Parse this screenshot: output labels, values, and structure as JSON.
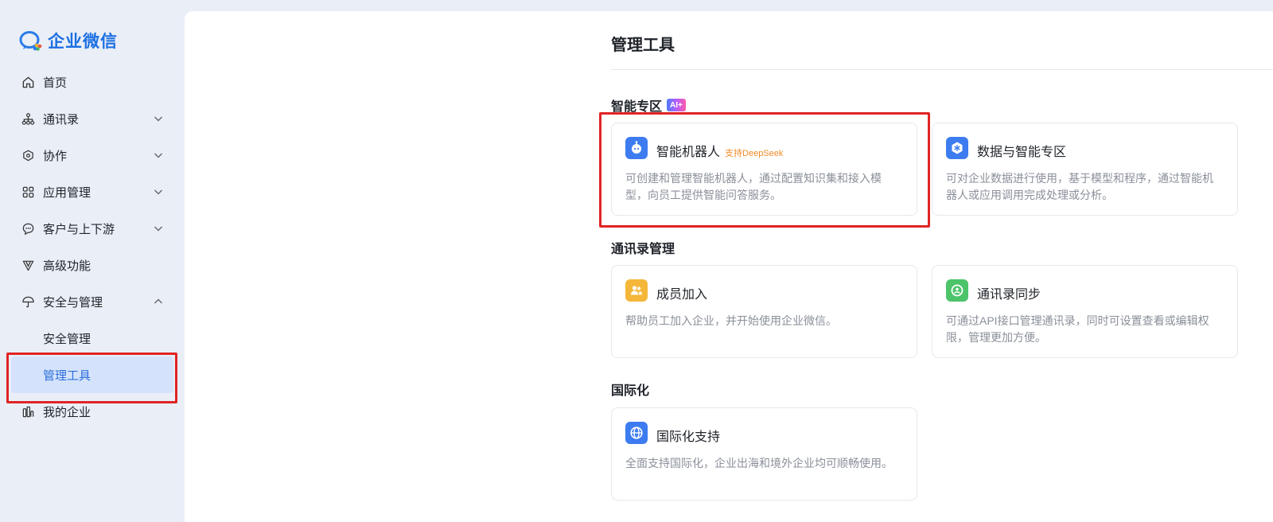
{
  "brand": {
    "name": "企业微信"
  },
  "sidebar": {
    "items": [
      {
        "label": "首页",
        "icon": "home-icon"
      },
      {
        "label": "通讯录",
        "icon": "org-icon",
        "chevron": "down"
      },
      {
        "label": "协作",
        "icon": "collab-icon",
        "chevron": "down"
      },
      {
        "label": "应用管理",
        "icon": "apps-icon",
        "chevron": "down"
      },
      {
        "label": "客户与上下游",
        "icon": "chat-icon",
        "chevron": "down"
      },
      {
        "label": "高级功能",
        "icon": "advanced-icon"
      },
      {
        "label": "安全与管理",
        "icon": "umbrella-icon",
        "chevron": "up"
      },
      {
        "label": "安全管理"
      },
      {
        "label": "管理工具",
        "active": true
      },
      {
        "label": "我的企业",
        "icon": "company-icon"
      }
    ]
  },
  "main": {
    "title": "管理工具",
    "sections": [
      {
        "title": "智能专区",
        "badge": "AI+"
      },
      {
        "title": "通讯录管理"
      },
      {
        "title": "国际化"
      }
    ],
    "cards": [
      {
        "title": "智能机器人",
        "tag": "支持DeepSeek",
        "desc": "可创建和管理智能机器人，通过配置知识集和接入模型，向员工提供智能问答服务。",
        "icon": "robot-icon",
        "color": "#3d7cf0"
      },
      {
        "title": "数据与智能专区",
        "desc": "可对企业数据进行使用，基于模型和程序，通过智能机器人或应用调用完成处理或分析。",
        "icon": "data-icon",
        "color": "#3d7cf0"
      },
      {
        "title": "成员加入",
        "desc": "帮助员工加入企业，并开始使用企业微信。",
        "icon": "member-join-icon",
        "color": "#f4b73a"
      },
      {
        "title": "通讯录同步",
        "desc": "可通过API接口管理通讯录，同时可设置查看或编辑权限，管理更加方便。",
        "icon": "sync-icon",
        "color": "#4cc46a"
      },
      {
        "title": "国际化支持",
        "desc": "全面支持国际化，企业出海和境外企业均可顺畅使用。",
        "icon": "globe-icon",
        "color": "#3d7cf0"
      }
    ]
  },
  "colors": {
    "accent": "#2c6fdc",
    "highlight": "#e02424",
    "active_bg": "#d4e3fb"
  }
}
